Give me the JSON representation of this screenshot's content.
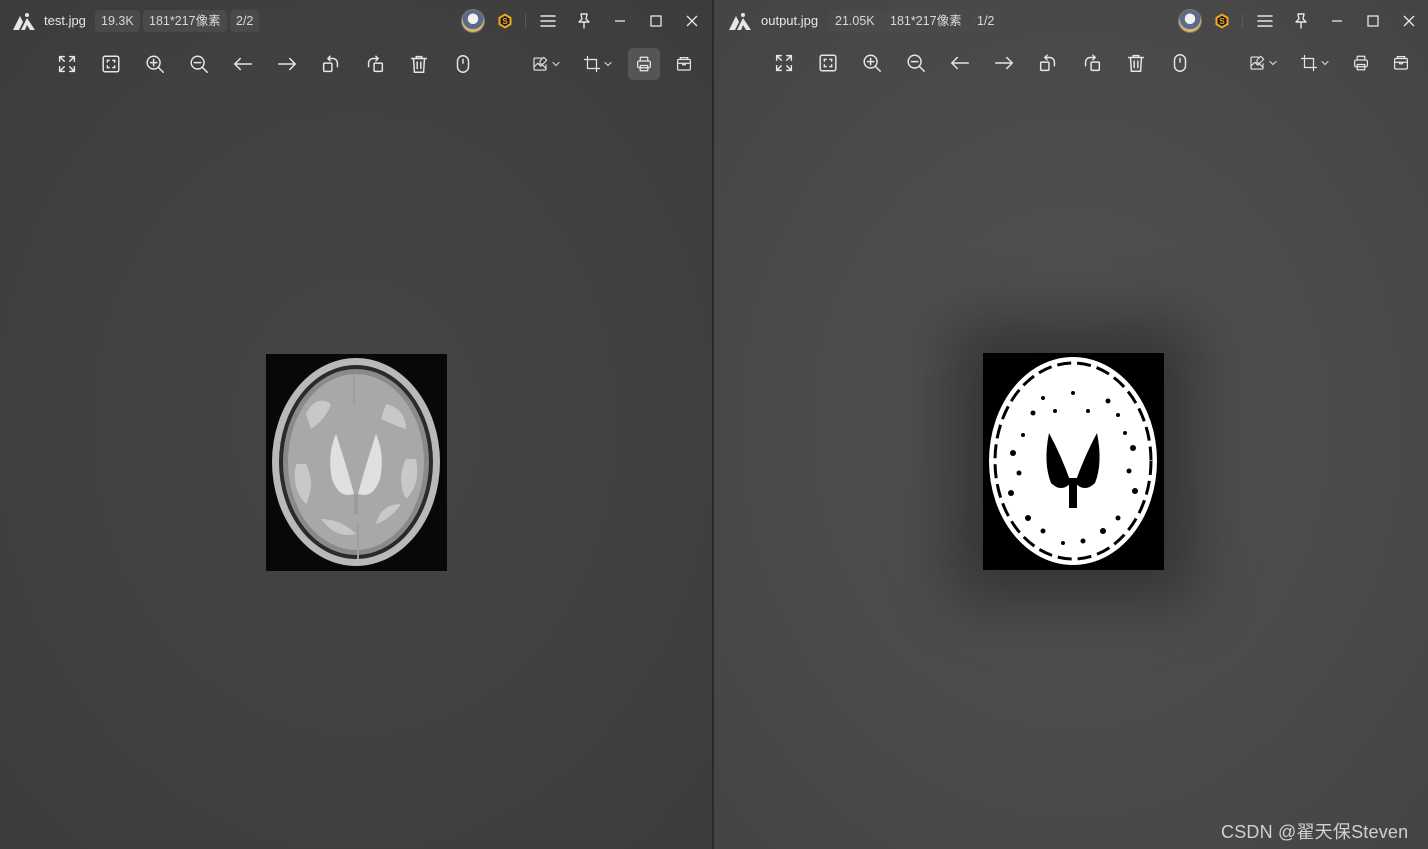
{
  "left_window": {
    "file_name": "test.jpg",
    "file_size": "19.3K",
    "dimensions": "181*217像素",
    "page_index": "2/2",
    "image_type": "grayscale brain mri"
  },
  "right_window": {
    "file_name": "output.jpg",
    "file_size": "21.05K",
    "dimensions": "181*217像素",
    "page_index": "1/2",
    "image_type": "binary thresholded brain mri"
  },
  "toolbar_icons": [
    "fullscreen-icon",
    "fit-window-icon",
    "zoom-in-icon",
    "zoom-out-icon",
    "previous-icon",
    "next-icon",
    "rotate-left-icon",
    "rotate-right-icon",
    "delete-icon",
    "mouse-icon",
    "image-edit-icon",
    "crop-icon",
    "print-icon",
    "open-folder-icon"
  ],
  "watermark": {
    "text": "CSDN @翟天保Steven"
  },
  "colors": {
    "accent_badge": "#f5a623",
    "text": "#e8e8e8",
    "badge_bg": "#4a4a4a"
  }
}
